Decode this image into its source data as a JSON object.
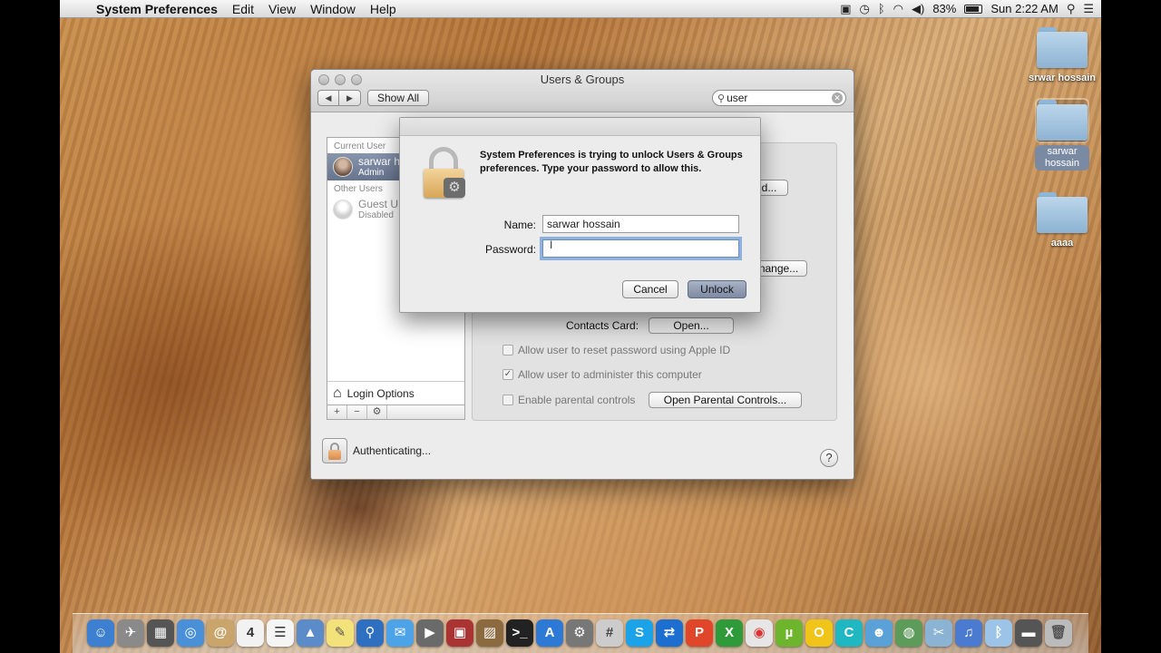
{
  "menubar": {
    "app_name": "System Preferences",
    "items": [
      "Edit",
      "View",
      "Window",
      "Help"
    ],
    "battery_percent": "83%",
    "clock": "Sun 2:22 AM"
  },
  "desktop_icons": [
    {
      "label": "srwar hossain"
    },
    {
      "label": "sarwar hossain"
    },
    {
      "label": "aaaa"
    }
  ],
  "window": {
    "title": "Users & Groups",
    "show_all_label": "Show All",
    "search_value": "user",
    "users": {
      "current_header": "Current User",
      "current_name": "sarwar h",
      "current_role": "Admin",
      "other_header": "Other Users",
      "guest_name": "Guest U",
      "guest_status": "Disabled"
    },
    "login_options_label": "Login Options",
    "tools": [
      "+",
      "−",
      "⚙"
    ],
    "panel": {
      "btn_password_partial": "d...",
      "btn_change_partial": "nange...",
      "contacts_card_label": "Contacts Card:",
      "open_label": "Open...",
      "reset_password_label": "Allow user to reset password using Apple ID",
      "administer_label": "Allow user to administer this computer",
      "parental_label": "Enable parental controls",
      "open_parental_label": "Open Parental Controls..."
    },
    "status_text": "Authenticating...",
    "help_label": "?"
  },
  "dialog": {
    "message": "System Preferences is trying to unlock Users & Groups preferences. Type your password to allow this.",
    "name_label": "Name:",
    "name_value": "sarwar hossain",
    "password_label": "Password:",
    "password_value": "",
    "cancel_label": "Cancel",
    "unlock_label": "Unlock"
  },
  "colors": {
    "selection": "#6f7d97",
    "default_button": "#8b96ad",
    "focus_ring": "#8fb1dd"
  }
}
